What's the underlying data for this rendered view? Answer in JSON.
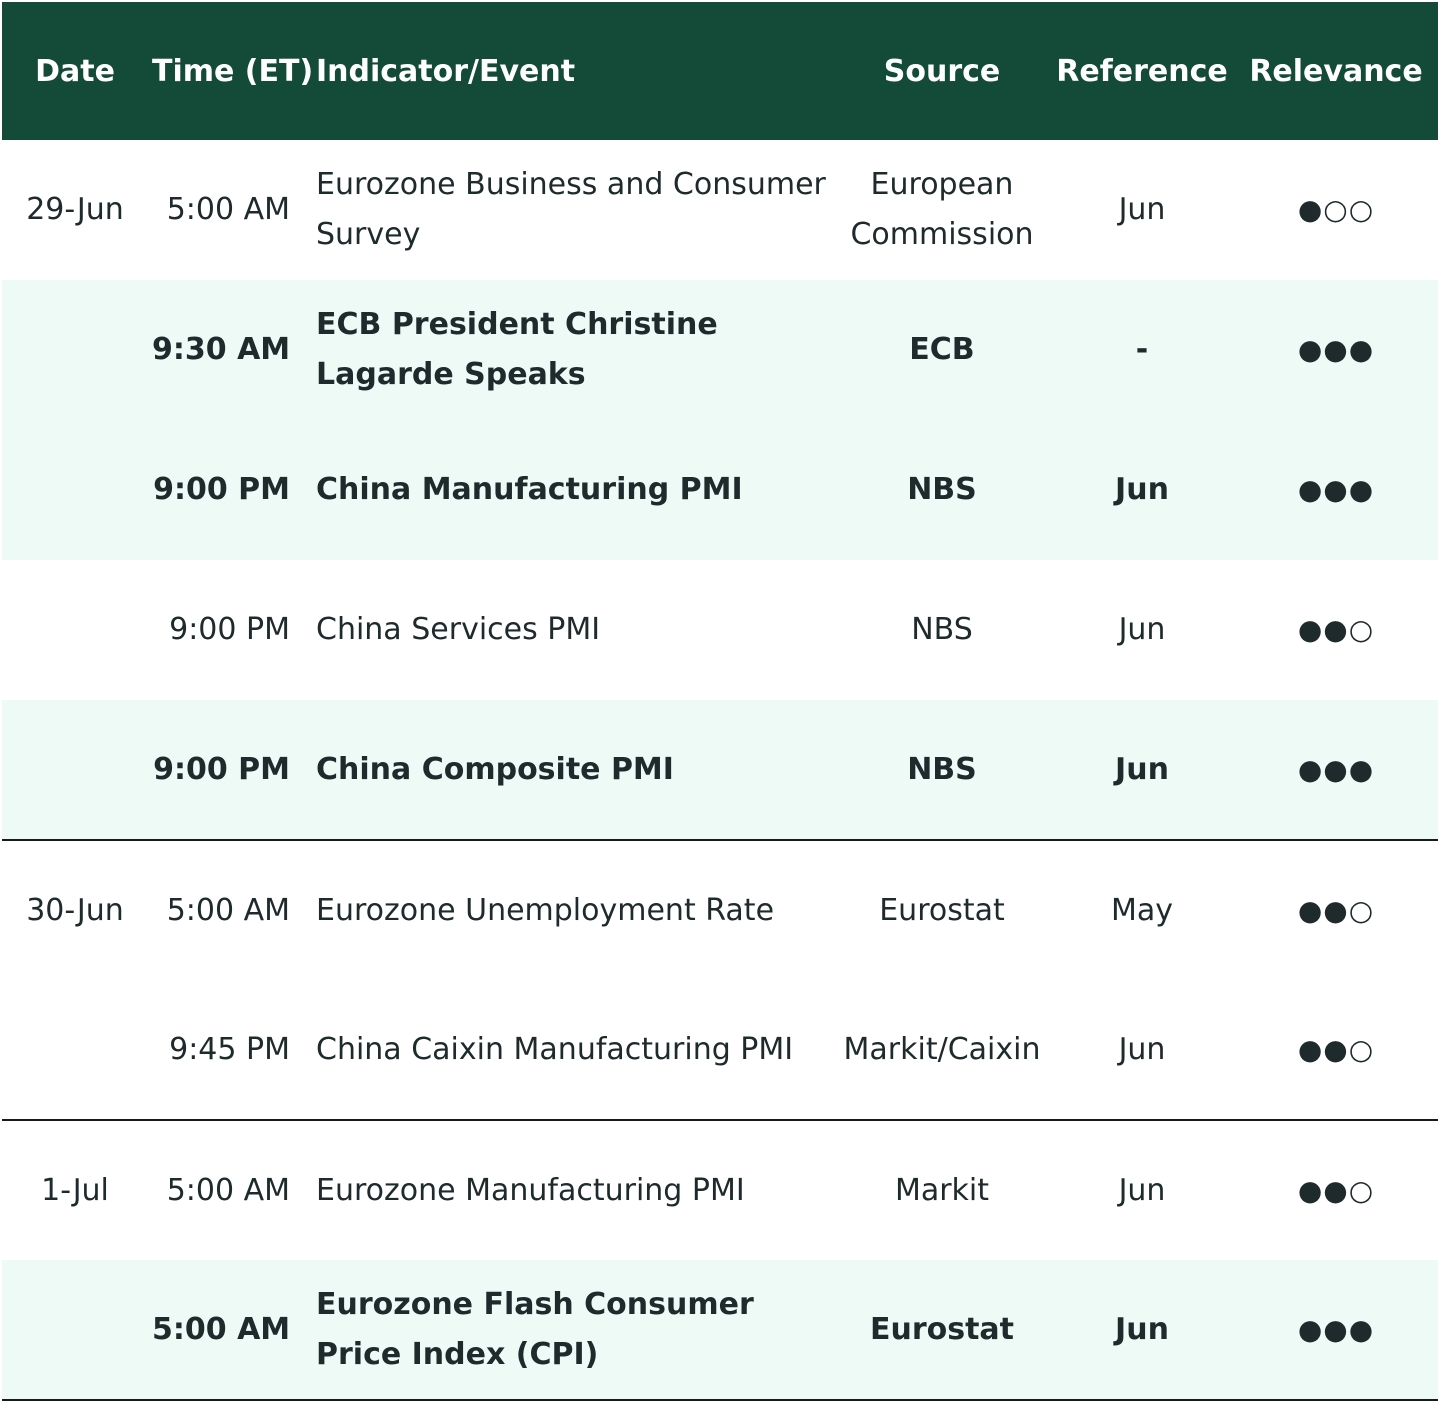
{
  "header": {
    "date": "Date",
    "time": "Time (ET)",
    "indicator": "Indicator/Event",
    "source": "Source",
    "reference": "Reference",
    "relevance": "Relevance"
  },
  "rows": [
    {
      "date": "29-Jun",
      "time": "5:00 AM",
      "indicator": "Eurozone Business and Consumer Survey",
      "source": "European Commission",
      "reference": "Jun",
      "relevance": "●○○"
    },
    {
      "date": "",
      "time": "9:30 AM",
      "indicator": "ECB President Christine Lagarde Speaks",
      "source": "ECB",
      "reference": "-",
      "relevance": "●●●"
    },
    {
      "date": "",
      "time": "9:00 PM",
      "indicator": "China Manufacturing PMI",
      "source": "NBS",
      "reference": "Jun",
      "relevance": "●●●"
    },
    {
      "date": "",
      "time": "9:00 PM",
      "indicator": "China Services PMI",
      "source": "NBS",
      "reference": "Jun",
      "relevance": "●●○"
    },
    {
      "date": "",
      "time": "9:00 PM",
      "indicator": "China Composite PMI",
      "source": "NBS",
      "reference": "Jun",
      "relevance": "●●●"
    },
    {
      "date": "30-Jun",
      "time": "5:00 AM",
      "indicator": "Eurozone Unemployment Rate",
      "source": "Eurostat",
      "reference": "May",
      "relevance": "●●○"
    },
    {
      "date": "",
      "time": "9:45 PM",
      "indicator": "China Caixin Manufacturing PMI",
      "source": "Markit/Caixin",
      "reference": "Jun",
      "relevance": "●●○"
    },
    {
      "date": "1-Jul",
      "time": "5:00 AM",
      "indicator": "Eurozone Manufacturing PMI",
      "source": "Markit",
      "reference": "Jun",
      "relevance": "●●○"
    },
    {
      "date": "",
      "time": "5:00 AM",
      "indicator": "Eurozone Flash Consumer Price Index (CPI)",
      "source": "Eurostat",
      "reference": "Jun",
      "relevance": "●●●"
    }
  ],
  "colors": {
    "header_bg": "#134b38",
    "header_text": "#ffffff",
    "shaded_row_bg": "#eefaf6",
    "group_divider": "#1a1a1a"
  }
}
